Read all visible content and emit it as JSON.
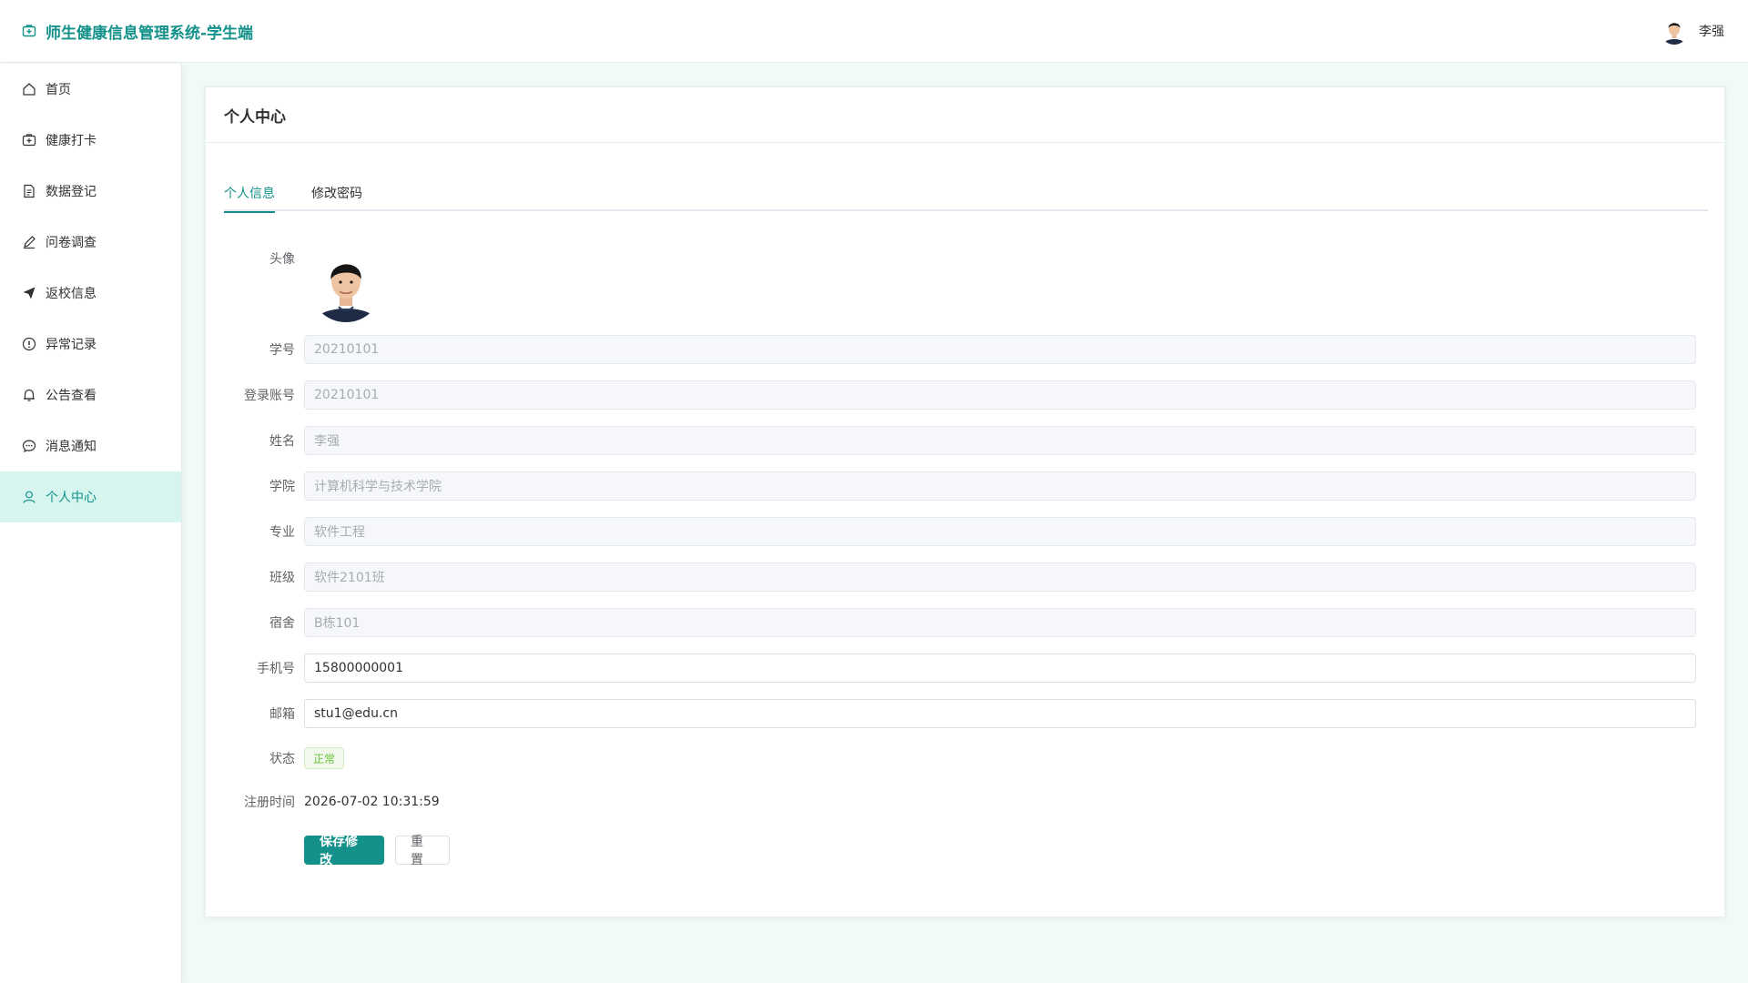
{
  "app": {
    "title": "师生健康信息管理系统-学生端",
    "user_name": "李强",
    "brand_color": "#13918a"
  },
  "sidebar": {
    "items": [
      {
        "label": "首页",
        "icon": "home-icon",
        "active": false
      },
      {
        "label": "健康打卡",
        "icon": "first-aid-icon",
        "active": false
      },
      {
        "label": "数据登记",
        "icon": "document-icon",
        "active": false
      },
      {
        "label": "问卷调查",
        "icon": "edit-pen-icon",
        "active": false
      },
      {
        "label": "返校信息",
        "icon": "paper-plane-icon",
        "active": false
      },
      {
        "label": "异常记录",
        "icon": "warning-circle-icon",
        "active": false
      },
      {
        "label": "公告查看",
        "icon": "bell-icon",
        "active": false
      },
      {
        "label": "消息通知",
        "icon": "chat-bubble-icon",
        "active": false
      },
      {
        "label": "个人中心",
        "icon": "user-icon",
        "active": true
      }
    ]
  },
  "page": {
    "title": "个人中心",
    "tabs": [
      {
        "label": "个人信息",
        "active": true
      },
      {
        "label": "修改密码",
        "active": false
      }
    ]
  },
  "form": {
    "avatar_label": "头像",
    "fields": [
      {
        "label": "学号",
        "value": "20210101",
        "disabled": true
      },
      {
        "label": "登录账号",
        "value": "20210101",
        "disabled": true
      },
      {
        "label": "姓名",
        "value": "李强",
        "disabled": true
      },
      {
        "label": "学院",
        "value": "计算机科学与技术学院",
        "disabled": true
      },
      {
        "label": "专业",
        "value": "软件工程",
        "disabled": true
      },
      {
        "label": "班级",
        "value": "软件2101班",
        "disabled": true
      },
      {
        "label": "宿舍",
        "value": "B栋101",
        "disabled": true
      },
      {
        "label": "手机号",
        "value": "15800000001",
        "disabled": false
      },
      {
        "label": "邮箱",
        "value": "stu1@edu.cn",
        "disabled": false
      }
    ],
    "status_label": "状态",
    "status_value": "正常",
    "register_label": "注册时间",
    "register_value": "2026-07-02 10:31:59",
    "save_label": "保存修改",
    "reset_label": "重置"
  }
}
